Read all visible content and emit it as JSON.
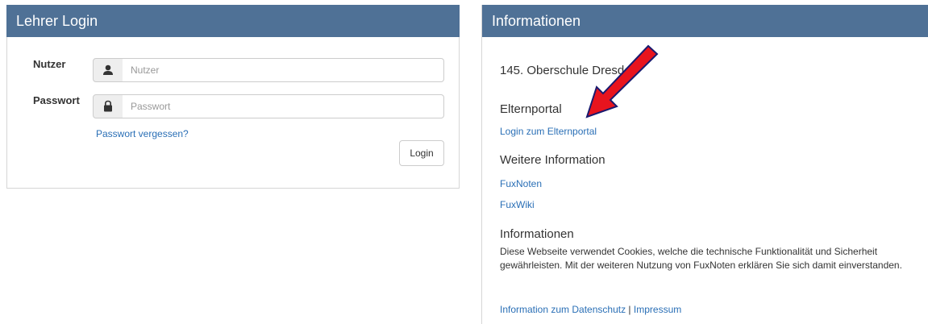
{
  "login": {
    "title": "Lehrer Login",
    "user_label": "Nutzer",
    "user_placeholder": "Nutzer",
    "password_label": "Passwort",
    "password_placeholder": "Passwort",
    "forgot_link": "Passwort vergessen?",
    "login_button": "Login"
  },
  "info": {
    "title": "Informationen",
    "school_name": "145. Oberschule Dresden",
    "elternportal_heading": "Elternportal",
    "elternportal_link": "Login zum Elternportal",
    "more_info_heading": "Weitere Information",
    "fuxnoten_link": "FuxNoten",
    "fuxwiki_link": "FuxWiki",
    "informationen_heading": "Informationen",
    "cookie_text": "Diese Webseite verwendet Cookies, welche die technische Funktionalität und Sicherheit gewährleisten. Mit der weiteren Nutzung von FuxNoten erklären Sie sich damit einverstanden.",
    "datenschutz_link": "Information zum Datenschutz",
    "separator": "|",
    "impressum_link": "Impressum"
  },
  "colors": {
    "header_bg": "#4f7196",
    "link": "#2a6fb6",
    "annotation_arrow": "#e8141e"
  },
  "icons": {
    "user_field": "user-icon",
    "password_field": "lock-icon",
    "annotation": "red-arrow-icon"
  }
}
